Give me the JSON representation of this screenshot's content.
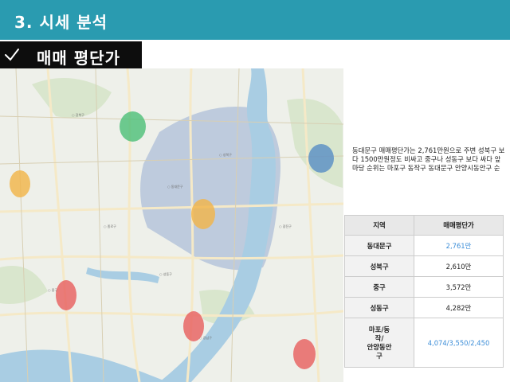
{
  "header": {
    "title": "3. 시세 분석"
  },
  "section": {
    "title": "매매 평단가",
    "icon": "check-icon"
  },
  "description": "동대문구 매매평단가는 2,761만원으로 주변 성북구 보다 1500만원정도 비싸고 중구나 성동구 보다 싸다 앞마당 순위는 마포구 동작구 동대문구 안양시동안구 순",
  "table": {
    "headers": [
      "지역",
      "매매평단가"
    ],
    "rows": [
      {
        "region": "동대문구",
        "price": "2,761만",
        "highlight": true
      },
      {
        "region": "성북구",
        "price": "2,610만",
        "highlight": false
      },
      {
        "region": "중구",
        "price": "3,572만",
        "highlight": false
      },
      {
        "region": "성동구",
        "price": "4,282만",
        "highlight": false
      },
      {
        "region": "마포/동\n작/\n안양동안\n구",
        "price": "4,074/3,550/2,450",
        "highlight": true
      }
    ]
  },
  "map": {
    "colors": {
      "water": "#a9cde3",
      "land": "#eef0ea",
      "highlight": "#aebfd8",
      "road": "#f7f3e4"
    },
    "markers": [
      {
        "name": "green-marker",
        "color": "#4fbf7a"
      },
      {
        "name": "blue-marker",
        "color": "#5a8fc4"
      },
      {
        "name": "orange-marker-west",
        "color": "#f2b54a"
      },
      {
        "name": "orange-marker-center",
        "color": "#f2b54a"
      },
      {
        "name": "red-marker-west",
        "color": "#e86060"
      },
      {
        "name": "red-marker-south",
        "color": "#e86060"
      },
      {
        "name": "red-marker-southeast",
        "color": "#e86060"
      }
    ]
  }
}
